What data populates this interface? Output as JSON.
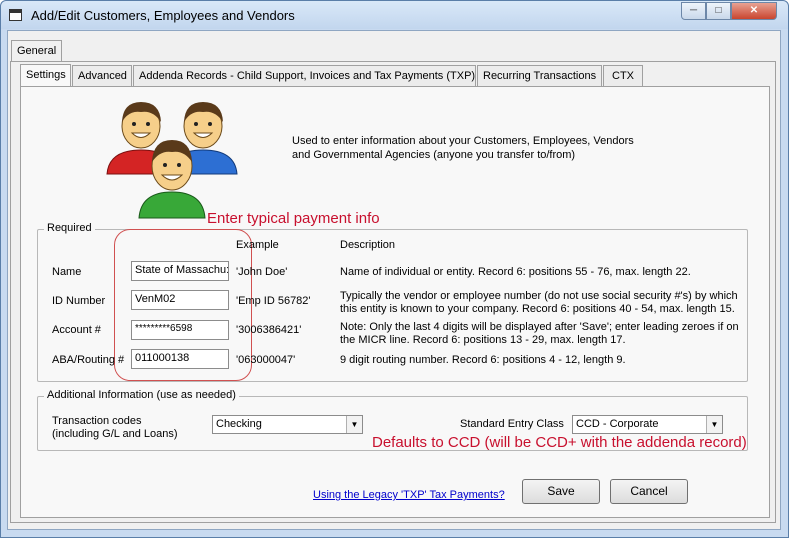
{
  "window": {
    "title": "Add/Edit Customers, Employees and Vendors"
  },
  "tabs_outer": [
    {
      "label": "General"
    }
  ],
  "tabs_inner": [
    {
      "label": "Settings"
    },
    {
      "label": "Advanced"
    },
    {
      "label": "Addenda Records - Child Support, Invoices and Tax Payments (TXP)"
    },
    {
      "label": "Recurring Transactions"
    },
    {
      "label": "CTX"
    }
  ],
  "intro": {
    "line1": "Used to enter information about your Customers, Employees, Vendors",
    "line2": "and Governmental Agencies (anyone you transfer to/from)"
  },
  "annotations": {
    "typical": "Enter typical payment info",
    "defaults": "Defaults to CCD (will be CCD+ with the addenda record)"
  },
  "required": {
    "group_label": "Required",
    "col_example": "Example",
    "col_description": "Description",
    "rows": [
      {
        "label": "Name",
        "value": "State of Massachu:",
        "example": "'John Doe'",
        "desc1": "Name of individual or entity. Record 6: positions 55 - 76, max. length 22.",
        "desc2": ""
      },
      {
        "label": "ID Number",
        "value": "VenM02",
        "example": "'Emp ID 56782'",
        "desc1": "Typically the vendor or employee number (do not use social security #'s) by which",
        "desc2": "this entity is known to your company. Record 6: positions 40 - 54, max. length 15."
      },
      {
        "label": "Account #",
        "value": "*********6598",
        "example": "'3006386421'",
        "desc1": "Note: Only the last 4 digits will be displayed after 'Save'; enter leading zeroes if on",
        "desc2": "the MICR line. Record 6: positions 13 - 29, max. length 17."
      },
      {
        "label": "ABA/Routing #",
        "value": "011000138",
        "example": "'063000047'",
        "desc1": "9 digit routing number. Record 6: positions 4 - 12, length 9.",
        "desc2": ""
      }
    ]
  },
  "additional": {
    "group_label": "Additional Information (use as needed)",
    "tx_codes_label1": "Transaction codes",
    "tx_codes_label2": "(including G/L and Loans)",
    "tx_codes_value": "Checking",
    "sec_label": "Standard Entry Class",
    "sec_value": "CCD - Corporate"
  },
  "footer": {
    "link": "Using the Legacy 'TXP' Tax Payments?",
    "save": "Save",
    "cancel": "Cancel"
  },
  "icons": {
    "users": "users-icon",
    "window": "window-icon"
  },
  "colors": {
    "annotation": "#c8102e",
    "link": "#0000cc"
  }
}
